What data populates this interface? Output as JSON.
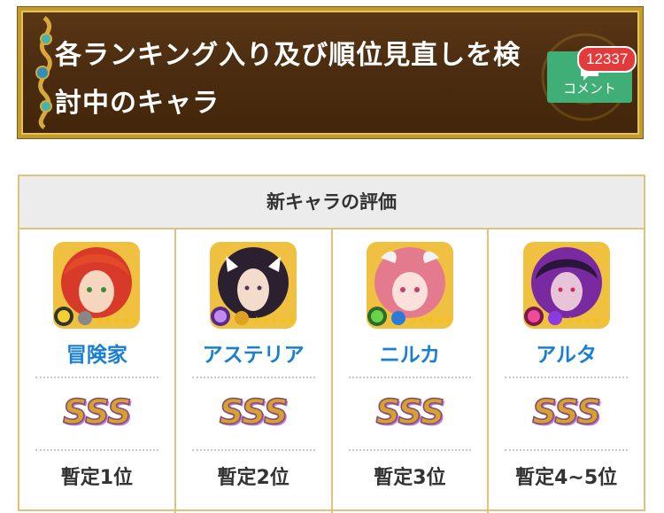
{
  "header": {
    "title_line1": "各ランキング入り及び順位見直しを検",
    "title_line2": "討中のキャラ",
    "comment_label": "コメント",
    "comment_count": "12337"
  },
  "table": {
    "heading": "新キャラの評価",
    "characters": [
      {
        "name": "冒険家",
        "grade": "SSS",
        "rank": "暫定1位",
        "portrait": "red-hair-hero-portrait",
        "frame_color": "#e8a32a"
      },
      {
        "name": "アステリア",
        "grade": "SSS",
        "rank": "暫定2位",
        "portrait": "dark-hair-woman-portrait",
        "frame_color": "#e8a32a"
      },
      {
        "name": "ニルカ",
        "grade": "SSS",
        "rank": "暫定3位",
        "portrait": "pink-hair-girl-portrait",
        "frame_color": "#e8a32a"
      },
      {
        "name": "アルタ",
        "grade": "SSS",
        "rank": "暫定4~5位",
        "portrait": "purple-hair-man-portrait",
        "frame_color": "#e8a32a"
      }
    ]
  },
  "colors": {
    "banner_bg": "#4b2c10",
    "banner_border": "#c49a2c",
    "comment_green": "#3fae77",
    "badge_red": "#e33b3b",
    "name_blue": "#1a7fd0",
    "table_border": "#e1c27a"
  }
}
